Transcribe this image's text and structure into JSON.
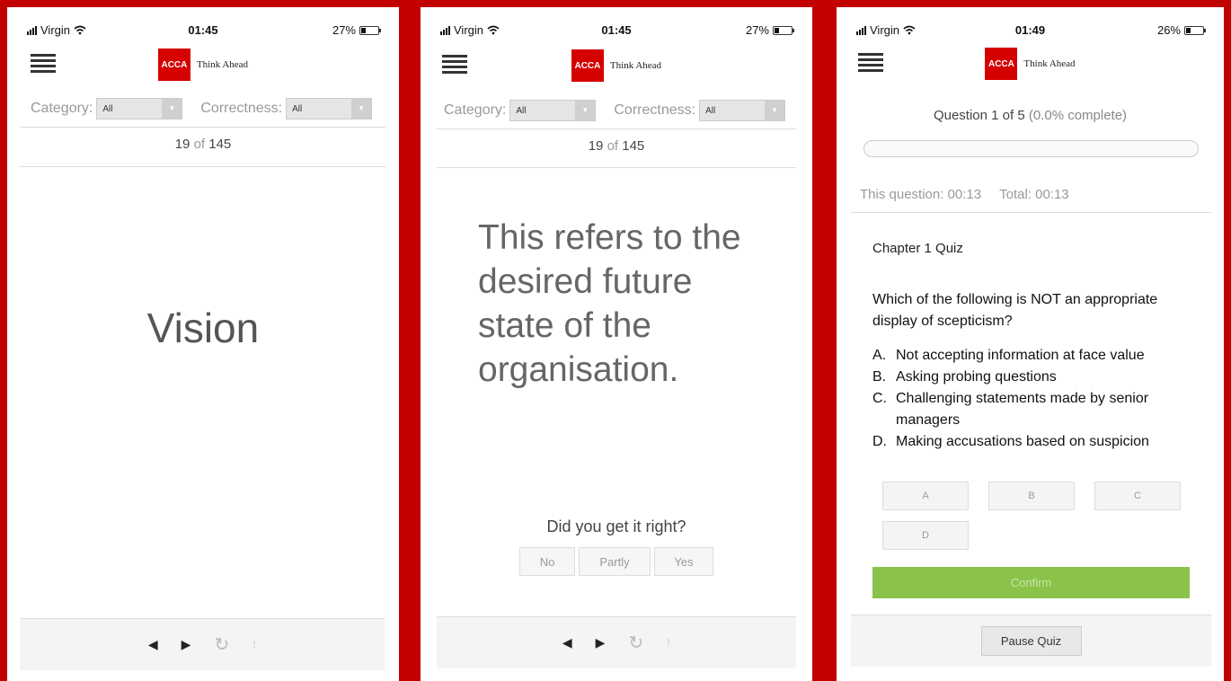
{
  "screens": [
    {
      "status": {
        "carrier": "Virgin",
        "time": "01:45",
        "battery": "27%",
        "battery_level": 0.27
      },
      "brand": {
        "logo": "ACCA",
        "tagline": "Think Ahead"
      },
      "filters": {
        "category_label": "Category:",
        "category_value": "All",
        "correctness_label": "Correctness:",
        "correctness_value": "All"
      },
      "counter": {
        "current": "19",
        "of": "of",
        "total": "145"
      },
      "card_text": "Vision",
      "footer_icons": [
        "prev-icon",
        "next-icon",
        "refresh-icon",
        "flip-icon"
      ]
    },
    {
      "status": {
        "carrier": "Virgin",
        "time": "01:45",
        "battery": "27%",
        "battery_level": 0.27
      },
      "brand": {
        "logo": "ACCA",
        "tagline": "Think Ahead"
      },
      "filters": {
        "category_label": "Category:",
        "category_value": "All",
        "correctness_label": "Correctness:",
        "correctness_value": "All"
      },
      "counter": {
        "current": "19",
        "of": "of",
        "total": "145"
      },
      "card_text": "This refers to the desired future state of the organisation.",
      "prompt": "Did you get it right?",
      "buttons": {
        "no": "No",
        "partly": "Partly",
        "yes": "Yes"
      },
      "footer_icons": [
        "prev-icon",
        "next-icon",
        "refresh-icon",
        "flip-icon"
      ]
    },
    {
      "status": {
        "carrier": "Virgin",
        "time": "01:49",
        "battery": "26%",
        "battery_level": 0.26
      },
      "brand": {
        "logo": "ACCA",
        "tagline": "Think Ahead"
      },
      "progress": {
        "question": "Question 1 of 5",
        "percent_text": "(0.0% complete)",
        "fraction": 0.0
      },
      "timers": {
        "question": "This question: 00:13",
        "total": "Total: 00:13"
      },
      "quiz_title": "Chapter 1 Quiz",
      "question": "Which of the following is NOT an appropriate display of scepticism?",
      "options": [
        {
          "letter": "A.",
          "text": "Not accepting information at face value"
        },
        {
          "letter": "B.",
          "text": "Asking probing questions"
        },
        {
          "letter": "C.",
          "text": "Challenging statements made by senior managers"
        },
        {
          "letter": "D.",
          "text": "Making accusations based on suspicion"
        }
      ],
      "answers": [
        "A",
        "B",
        "C",
        "D"
      ],
      "confirm": "Confirm",
      "pause": "Pause Quiz"
    }
  ]
}
